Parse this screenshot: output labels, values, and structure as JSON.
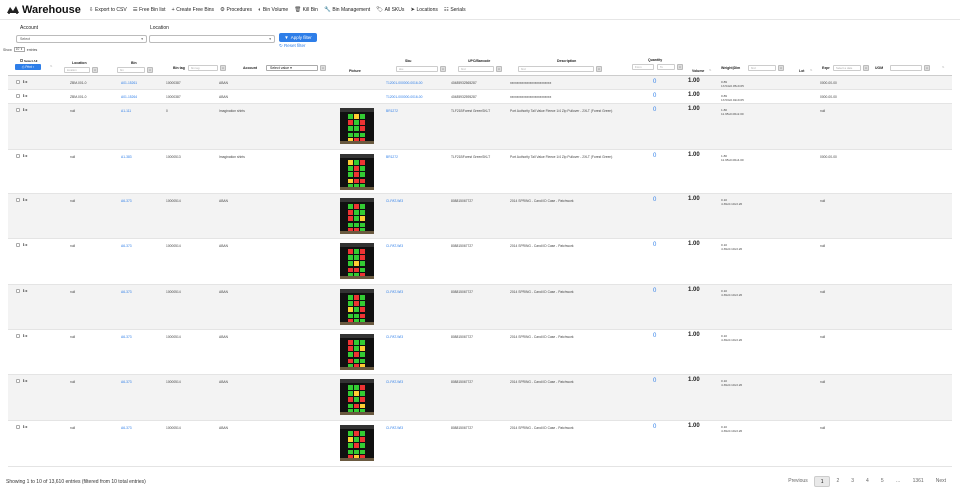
{
  "nav": {
    "brand": "Warehouse",
    "items": [
      {
        "icon": "export-icon",
        "glyph": "⇩",
        "label": "Export to CSV"
      },
      {
        "icon": "list-icon",
        "glyph": "☰",
        "label": "Free Bin list"
      },
      {
        "icon": "plus-icon",
        "glyph": "+",
        "label": "Create Free Bins"
      },
      {
        "icon": "gear-icon",
        "glyph": "⚙",
        "label": "Procedures"
      },
      {
        "icon": "volume-icon",
        "glyph": "◐",
        "label": "Bin Volume"
      },
      {
        "icon": "trash-icon",
        "glyph": "🗑",
        "label": "Kill Bin"
      },
      {
        "icon": "wrench-icon",
        "glyph": "🔧",
        "label": "Bin Management"
      },
      {
        "icon": "tags-icon",
        "glyph": "🏷",
        "label": "All SKUs"
      },
      {
        "icon": "location-arrow-icon",
        "glyph": "➤",
        "label": "Locations"
      },
      {
        "icon": "barcode-icon",
        "glyph": "☷",
        "label": "Serials"
      }
    ]
  },
  "filters": {
    "account_label": "Account",
    "account_value": "Select",
    "location_label": "Location",
    "location_value": "",
    "apply_label": "Apply filter",
    "reset_label": "Reset filter"
  },
  "show_entries": {
    "prefix": "Show",
    "value": "10",
    "suffix": "entries"
  },
  "table": {
    "select_all": "Select All",
    "print_label": "Print",
    "headers": {
      "location": "Location",
      "bin": "Bin",
      "bin_tag": "Bin tag",
      "account": "Account",
      "picture": "Picture",
      "sku": "Sku",
      "upc": "UPC/Barcode",
      "description": "Description",
      "quantity": "Quantity",
      "volume": "Volume",
      "weight": "Weight|Dim",
      "lot": "Lot",
      "expr": "Expr",
      "uom": "UOM"
    },
    "filters": {
      "location": "location",
      "bin": "bin",
      "bin_tag": "bin tag",
      "account": "Select value",
      "sku": "sku",
      "upc": "find",
      "description": "find",
      "qty_from": "From",
      "qty_to": "To",
      "weight": "find",
      "expr": "Select a date",
      "uom": ""
    },
    "rows": [
      {
        "location": "ZBM-001-0",
        "bin": "A01-15261",
        "bin_tag": "10000387",
        "account": "ABAN",
        "sku": "T12001-000000-0016-00",
        "upc": "40485932565287",
        "description": "xxxxxxxxxxxxxxxxxxxxxxxxx",
        "qty": "0",
        "volume": "1.00",
        "w1": "0.89",
        "w2": "13.54x0.05x9.65",
        "lot": "",
        "expr": "0000-00-00",
        "picture": false
      },
      {
        "location": "ZBM-001-0",
        "bin": "A01-15264",
        "bin_tag": "10000387",
        "account": "ABAN",
        "sku": "T12001-000000-0016-00",
        "upc": "40485932595287",
        "description": "xxxxxxxxxxxxxxxxxxxxxxxxx",
        "qty": "0",
        "volume": "1.00",
        "w1": "0.89",
        "w2": "13.53x0.02x9.65",
        "lot": "",
        "expr": "0000-00-00",
        "picture": false
      },
      {
        "location": "null",
        "bin": "A1-111",
        "bin_tag": "0",
        "account": "Imagination shirts",
        "sku": "BR1272",
        "upc": "TLF21BForest GreenSKLT",
        "description": "Port Authority Tall Value Fleece 1/4 Zip Pullover - 2XLT (Forest Green)",
        "qty": "0",
        "volume": "1.00",
        "w1": "1.80",
        "w2": "11.95x0.06x2.00",
        "lot": "",
        "expr": "null",
        "picture": true
      },
      {
        "location": "null",
        "bin": "A1-383",
        "bin_tag": "10000513",
        "account": "Imagination shirts",
        "sku": "BR1272",
        "upc": "TLF21BForest GreenSKLT",
        "description": "Port Authority Tall Value Fleece 1/4 Zip Pullover - 2XLT (Forest Green)",
        "qty": "0",
        "volume": "1.00",
        "w1": "1.80",
        "w2": "11.95x0.06x4.00",
        "lot": "",
        "expr": "0000-00-00",
        "picture": true
      },
      {
        "location": "null",
        "bin": "A6-373",
        "bin_tag": "10000514",
        "account": "ABAN",
        "sku": "CI-PAT-WI3",
        "upc": "808815067727",
        "description": "2014 SPRING - Candi ID Case - Patchwork",
        "qty": "0",
        "volume": "1.00",
        "w1": "0.10",
        "w2": "4.39x0.10x3.26",
        "lot": "",
        "expr": "null",
        "picture": true
      },
      {
        "location": "null",
        "bin": "A6-373",
        "bin_tag": "10000514",
        "account": "ABAN",
        "sku": "CI-PAT-WI3",
        "upc": "808815067727",
        "description": "2014 SPRING - Candi ID Case - Patchwork",
        "qty": "0",
        "volume": "1.00",
        "w1": "0.10",
        "w2": "4.39x0.10x3.26",
        "lot": "",
        "expr": "null",
        "picture": true
      },
      {
        "location": "null",
        "bin": "A6-373",
        "bin_tag": "10000514",
        "account": "ABAN",
        "sku": "CI-PAT-WI3",
        "upc": "808815067727",
        "description": "2014 SPRING - Candi ID Case - Patchwork",
        "qty": "0",
        "volume": "1.00",
        "w1": "0.10",
        "w2": "4.39x0.10x3.26",
        "lot": "",
        "expr": "null",
        "picture": true
      },
      {
        "location": "null",
        "bin": "A6-373",
        "bin_tag": "10000514",
        "account": "ABAN",
        "sku": "CI-PAT-WI3",
        "upc": "808815067727",
        "description": "2014 SPRING - Candi ID Case - Patchwork",
        "qty": "0",
        "volume": "1.00",
        "w1": "0.10",
        "w2": "4.39x0.10x3.26",
        "lot": "",
        "expr": "null",
        "picture": true
      },
      {
        "location": "null",
        "bin": "A6-373",
        "bin_tag": "10000514",
        "account": "ABAN",
        "sku": "CI-PAT-WI3",
        "upc": "808815067727",
        "description": "2014 SPRING - Candi ID Case - Patchwork",
        "qty": "0",
        "volume": "1.00",
        "w1": "0.10",
        "w2": "4.39x0.10x3.26",
        "lot": "",
        "expr": "null",
        "picture": true
      },
      {
        "location": "null",
        "bin": "A6-373",
        "bin_tag": "10000514",
        "account": "ABAN",
        "sku": "CI-PAT-WI3",
        "upc": "808815067727",
        "description": "2014 SPRING - Candi ID Case - Patchwork",
        "qty": "0",
        "volume": "1.00",
        "w1": "0.10",
        "w2": "4.39x0.10x3.26",
        "lot": "",
        "expr": "null",
        "picture": true
      }
    ]
  },
  "footer": {
    "summary": "Showing 1 to 10 of 13,610 entries (filtered from 10 total entries)",
    "pages": [
      "Previous",
      "1",
      "2",
      "3",
      "4",
      "5",
      "…",
      "1361",
      "Next"
    ],
    "active_page": "1"
  },
  "colors": {
    "accent": "#2e7ee8"
  }
}
